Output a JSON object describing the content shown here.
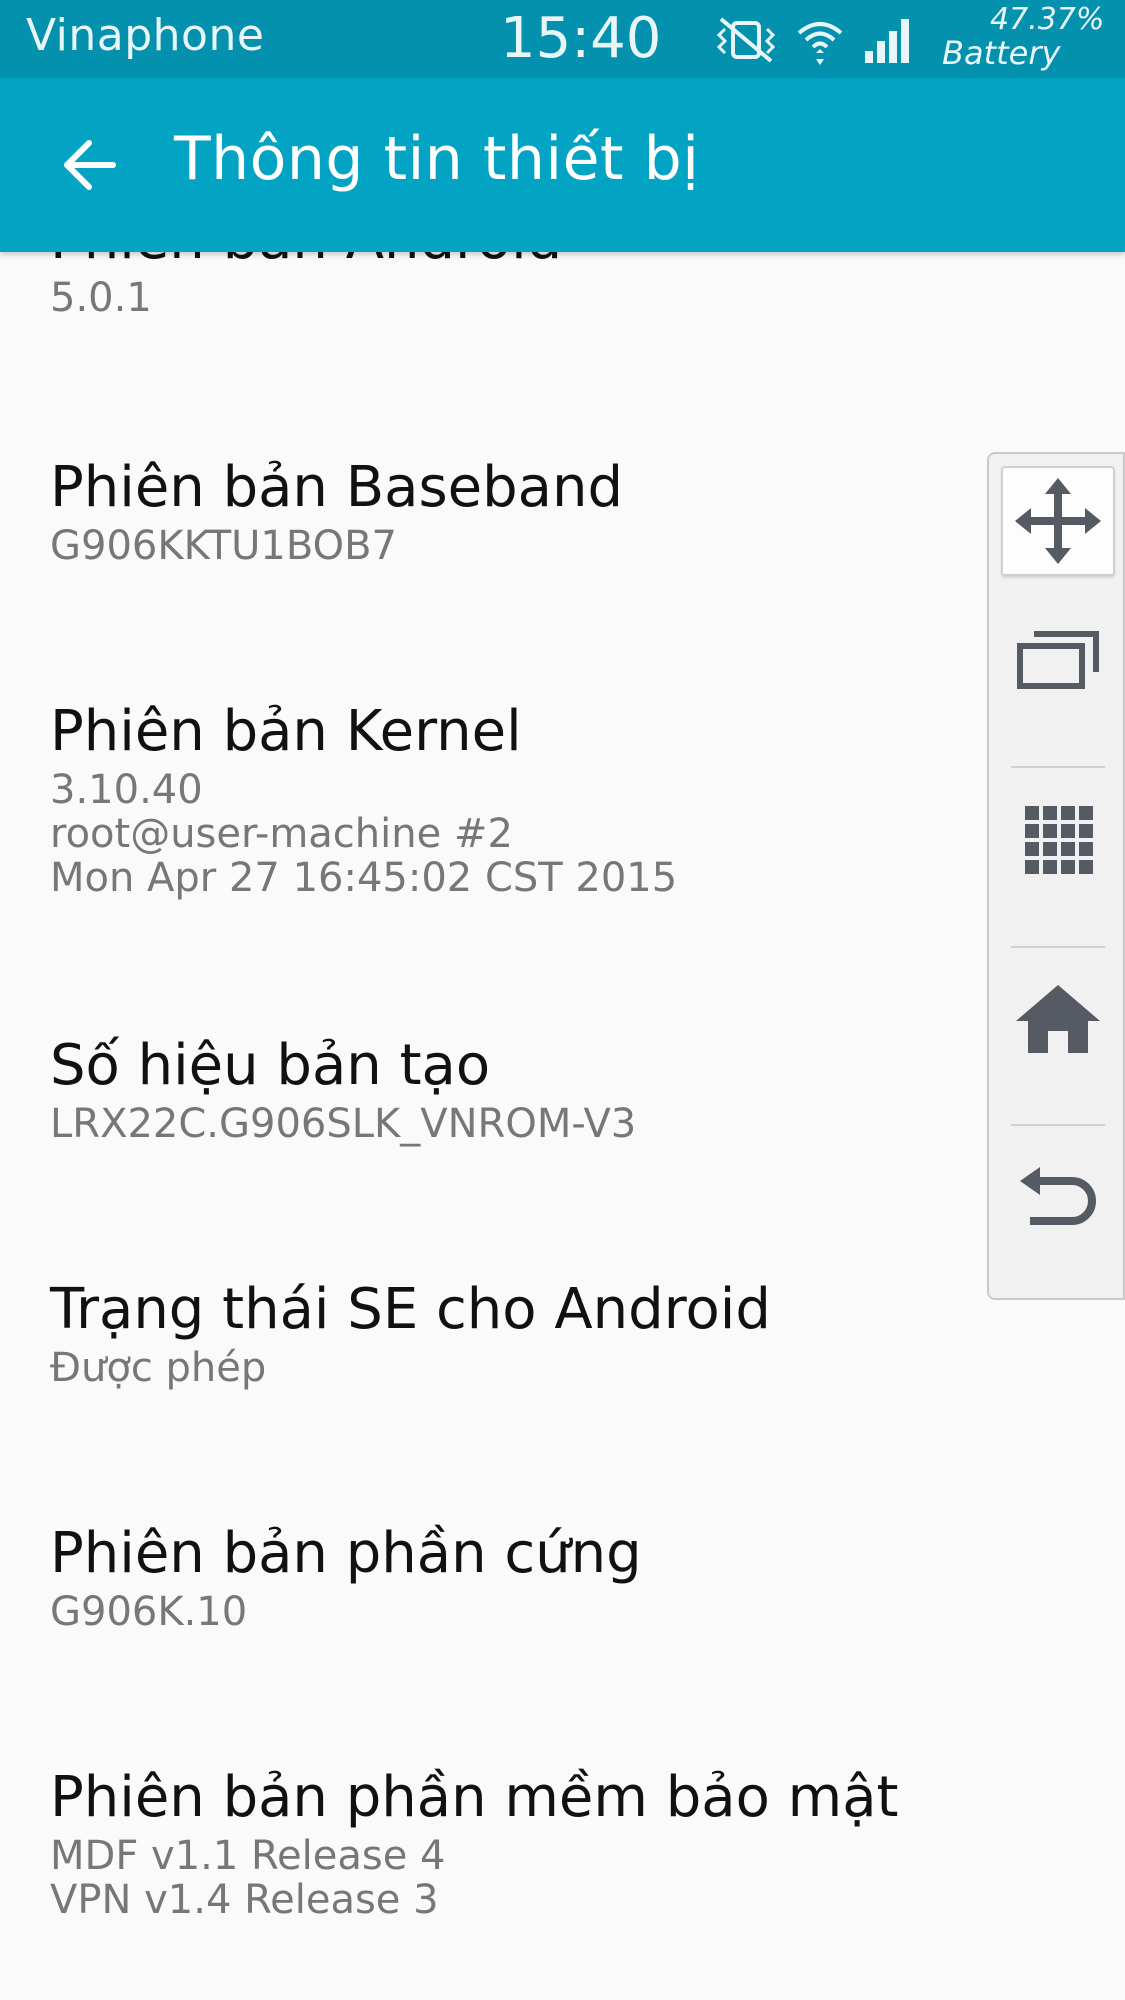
{
  "status_bar": {
    "carrier": "Vinaphone",
    "time": "15:40",
    "battery_percent": "47.37%",
    "battery_label": "Battery",
    "icons": [
      "vibrate-mute-icon",
      "wifi-icon",
      "signal-icon"
    ]
  },
  "app_bar": {
    "title": "Thông tin thiết bị",
    "back_icon": "arrow-left-icon"
  },
  "items": [
    {
      "title": "Phiên bản Android",
      "value": "5.0.1"
    },
    {
      "title": "Phiên bản Baseband",
      "value": "G906KKTU1BOB7"
    },
    {
      "title": "Phiên bản Kernel",
      "value_lines": [
        "3.10.40",
        "root@user-machine #2",
        "Mon Apr 27 16:45:02 CST 2015"
      ]
    },
    {
      "title": "Số hiệu bản tạo",
      "value": "LRX22C.G906SLK_VNROM-V3"
    },
    {
      "title": "Trạng thái SE cho Android",
      "value": "Được phép"
    },
    {
      "title": "Phiên bản phần cứng",
      "value": "G906K.10"
    },
    {
      "title": "Phiên bản phần mềm bảo mật",
      "value_lines": [
        "MDF v1.1 Release 4",
        "VPN v1.4 Release 3"
      ]
    }
  ],
  "floating_panel": {
    "buttons": [
      "move-icon",
      "recent-apps-icon",
      "apps-grid-icon",
      "home-icon",
      "back-icon"
    ]
  },
  "colors": {
    "status_bar": "#0391ad",
    "app_bar": "#03a3c4",
    "background": "#fafafa",
    "title_text": "#111111",
    "value_text": "#777777"
  }
}
